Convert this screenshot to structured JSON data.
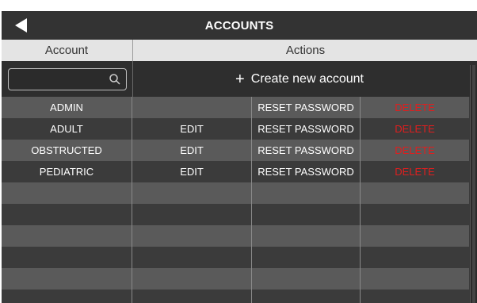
{
  "header": {
    "title": "ACCOUNTS",
    "back_icon": "back-arrow-icon"
  },
  "columns": {
    "account": "Account",
    "actions": "Actions"
  },
  "toolbar": {
    "search_value": "",
    "search_placeholder": "",
    "search_icon": "search-icon",
    "create_plus": "+",
    "create_label": "Create new account"
  },
  "accounts": [
    {
      "name": "ADMIN",
      "edit": "",
      "reset": "RESET PASSWORD",
      "delete": "DELETE"
    },
    {
      "name": "ADULT",
      "edit": "EDIT",
      "reset": "RESET PASSWORD",
      "delete": "DELETE"
    },
    {
      "name": "OBSTRUCTED",
      "edit": "EDIT",
      "reset": "RESET PASSWORD",
      "delete": "DELETE"
    },
    {
      "name": "PEDIATRIC",
      "edit": "EDIT",
      "reset": "RESET PASSWORD",
      "delete": "DELETE"
    }
  ],
  "colors": {
    "titlebar": "#333333",
    "header_bg": "#e4e4e4",
    "delete": "#e01e1e"
  }
}
